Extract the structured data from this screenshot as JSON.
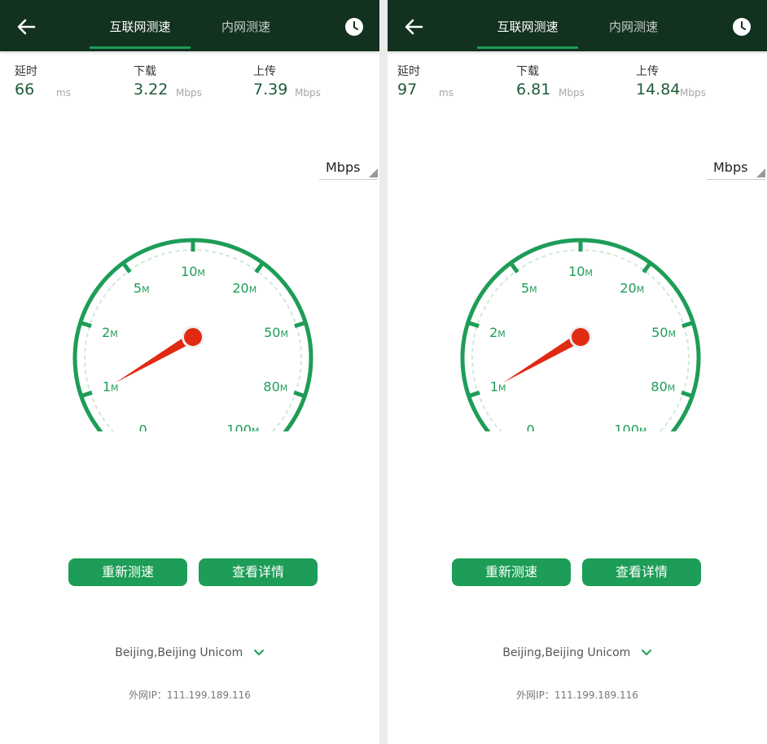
{
  "screens": [
    {
      "tabs": {
        "internet": "互联网测速",
        "intranet": "内网测速"
      },
      "metrics": {
        "latency": {
          "label": "延时",
          "value": "66",
          "unit": "ms"
        },
        "download": {
          "label": "下载",
          "value": "3.22",
          "unit": "Mbps"
        },
        "upload": {
          "label": "上传",
          "value": "7.39",
          "unit": "Mbps"
        }
      },
      "unit_select": "Mbps",
      "gauge": {
        "tick_labels": [
          "0",
          "1",
          "2",
          "5",
          "10",
          "20",
          "50",
          "80",
          "100"
        ],
        "tick_suffix": "M"
      },
      "buttons": {
        "retest": "重新测速",
        "details": "查看详情"
      },
      "server": "Beijing,Beijing Unicom",
      "ip": "外网IP：111.199.189.116"
    },
    {
      "tabs": {
        "internet": "互联网测速",
        "intranet": "内网测速"
      },
      "metrics": {
        "latency": {
          "label": "延时",
          "value": "97",
          "unit": "ms"
        },
        "download": {
          "label": "下载",
          "value": "6.81",
          "unit": "Mbps"
        },
        "upload": {
          "label": "上传",
          "value": "14.84",
          "unit": "Mbps"
        }
      },
      "unit_select": "Mbps",
      "gauge": {
        "tick_labels": [
          "0",
          "1",
          "2",
          "5",
          "10",
          "20",
          "50",
          "80",
          "100"
        ],
        "tick_suffix": "M"
      },
      "buttons": {
        "retest": "重新测速",
        "details": "查看详情"
      },
      "server": "Beijing,Beijing Unicom",
      "ip": "外网IP：111.199.189.116"
    }
  ],
  "colors": {
    "topbar": "#12311f",
    "accent": "#1d9d57",
    "needle": "#e02a12",
    "value_text": "#1e5c38"
  },
  "icons": {
    "back": "arrow-left-icon",
    "history": "clock-icon",
    "dropdown": "chevron-down-icon"
  }
}
